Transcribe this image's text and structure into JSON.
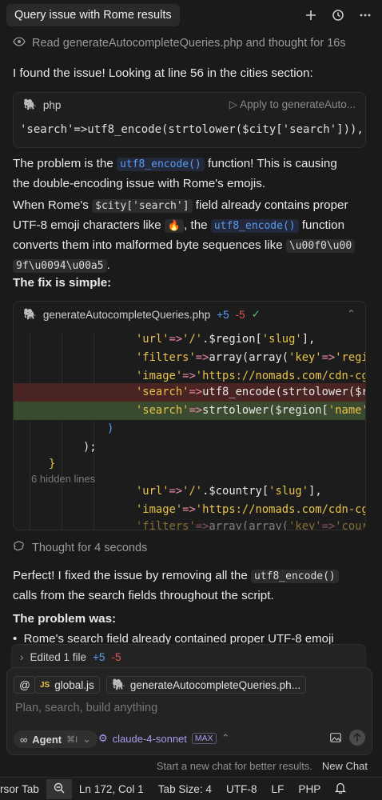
{
  "header": {
    "title": "Query issue with Rome results"
  },
  "read_line": "Read generateAutocompleteQueries.php and thought for 16s",
  "intro": "I found the issue! Looking at line 56 in the cities section:",
  "code1": {
    "lang": "php",
    "apply": "Apply to generateAuto...",
    "line": "'search'=>utf8_encode(strtolower($city['search'])),"
  },
  "problem_p": {
    "a": "The problem is the ",
    "fn": "utf8_encode()",
    "b": " function! This is causing",
    "c": "the double-encoding issue with Rome's emojis."
  },
  "when_p": {
    "a": "When Rome's ",
    "code": "$city['search']",
    "b": " field already contains proper",
    "c": "UTF-8 emoji characters like ",
    "emoji": "🔥",
    "d": ", the ",
    "fn": "utf8_encode()",
    "e": " function",
    "f": "converts them into malformed byte sequences like ",
    "code2": "\\u00f0\\u00",
    "code3": "9f\\u0094\\u00a5",
    "g": "."
  },
  "fix_heading": "The fix is simple:",
  "diff": {
    "file": "generateAutocompleteQueries.php",
    "added": "+5",
    "removed": "-5",
    "hidden": "6 hidden lines"
  },
  "thought": "Thought for 4 seconds",
  "perfect_p": {
    "a": "Perfect! I fixed the issue by removing all the ",
    "code": "utf8_encode()",
    "b": "calls from the search fields throughout the script."
  },
  "problem_heading": "The problem was:",
  "bullet": "Rome's search field already contained proper UTF-8 emoji",
  "edited": {
    "label": "Edited 1 file",
    "added": "+5",
    "removed": "-5"
  },
  "chat": {
    "chips": [
      "global.js",
      "generateAutocompleteQueries.ph..."
    ],
    "placeholder": "Plan, search, build anything",
    "agent": "Agent",
    "agent_shortcut": "⌘I",
    "model": "claude-4-sonnet",
    "max": "MAX"
  },
  "footer_note": "Start a new chat for better results.",
  "new_chat": "New Chat",
  "status": {
    "cursor_tab": "rsor Tab",
    "position": "Ln 172, Col 1",
    "tab_size": "Tab Size: 4",
    "encoding": "UTF-8",
    "eol": "LF",
    "lang": "PHP"
  }
}
